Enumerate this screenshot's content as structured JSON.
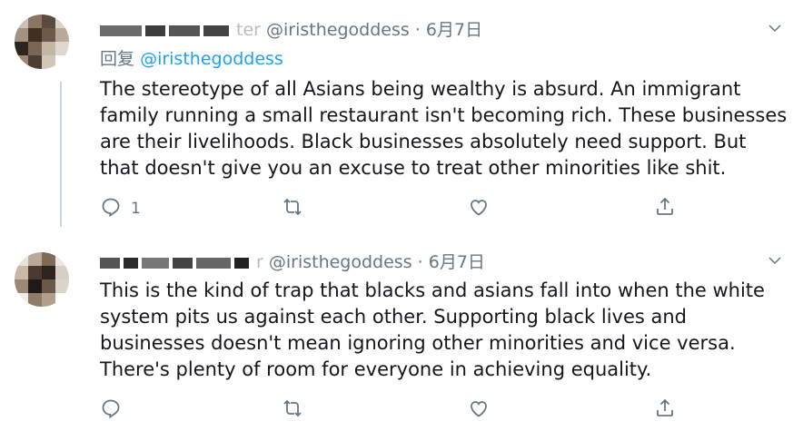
{
  "tweets": [
    {
      "name_hint": "ter",
      "handle": "@iristhegoddess",
      "separator": "·",
      "date": "6月7日",
      "reply_prefix": "回复",
      "reply_to": "@iristhegoddess",
      "text": "The stereotype of all Asians being wealthy is absurd. An immigrant family running a small restaurant isn't becoming rich. These businesses are their livelihoods. Black businesses absolutely need support. But that doesn't give you an excuse to treat other minorities like shit.",
      "reply_count": "1",
      "avatar_colors": [
        "#c9c2b8",
        "#8a7562",
        "#5b4a3f",
        "#d9d3cc",
        "#a3927f",
        "#3f3026",
        "#6d5a4a",
        "#b9aa97",
        "#2e2520",
        "#7b6656",
        "#c4b6a4",
        "#e0d8cf",
        "#9a8672",
        "#4d3d32",
        "#d2c6b7",
        "#ffffff"
      ]
    },
    {
      "name_hint": "r",
      "handle": "@iristhegoddess",
      "separator": "·",
      "date": "6月7日",
      "text": "This is the kind of trap that blacks and asians fall into when the white system pits us against each other. Supporting black lives and businesses doesn't mean ignoring other minorities and vice versa. There's plenty of room for everyone in achieving equality.",
      "reply_count": "",
      "avatar_colors": [
        "#e6e2dc",
        "#b8a99a",
        "#7f6a58",
        "#e9e6e1",
        "#c8b8a6",
        "#4a3a30",
        "#2d2420",
        "#d6cfc6",
        "#9c8775",
        "#1f1a17",
        "#6b5848",
        "#dcd5cc",
        "#f0ede9",
        "#8e7b69",
        "#b3a08c",
        "#ffffff"
      ]
    }
  ],
  "icons": {
    "chevron": "chevron-down-icon",
    "reply": "reply-icon",
    "retweet": "retweet-icon",
    "like": "like-icon",
    "share": "share-icon"
  },
  "colors": {
    "link": "#1da1f2",
    "secondary": "#657786",
    "text": "#14171a"
  }
}
